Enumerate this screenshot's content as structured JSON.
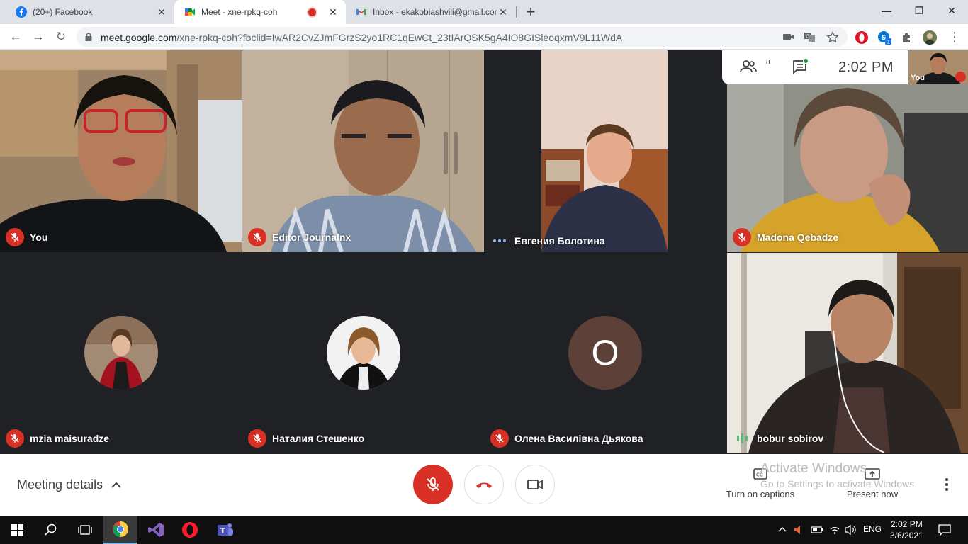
{
  "browser": {
    "tabs": [
      {
        "title": "(20+) Facebook",
        "icon": "facebook-icon"
      },
      {
        "title": "Meet - xne-rpkq-coh",
        "icon": "google-meet-icon",
        "recording": true
      },
      {
        "title": "Inbox - ekakobiashvili@gmail.com",
        "icon": "gmail-icon"
      }
    ],
    "url_host": "meet.google.com",
    "url_rest": "/xne-rpkq-coh?fbclid=IwAR2CvZJmFGrzS2yo1RC1qEwCt_23tIArQSK5gA4IO8GISleoqxmV9L11WdA",
    "extension_badge": "1"
  },
  "meet": {
    "participant_count": "8",
    "time": "2:02  PM",
    "self_label": "You",
    "participants": [
      {
        "name": "You",
        "status": "muted"
      },
      {
        "name": "Editor Journalnx",
        "status": "muted"
      },
      {
        "name": "Евгения Болотина",
        "status": "connecting"
      },
      {
        "name": "Madona Qebadze",
        "status": "muted"
      },
      {
        "name": "mzia maisuradze",
        "status": "muted"
      },
      {
        "name": "Наталия Стешенко",
        "status": "muted"
      },
      {
        "name": "Олена Василівна Дьякова",
        "status": "muted",
        "avatar_letter": "O"
      },
      {
        "name": "bobur sobirov",
        "status": "speaking"
      }
    ]
  },
  "controls": {
    "meeting_details": "Meeting details",
    "captions": "Turn on captions",
    "present": "Present now"
  },
  "watermark": {
    "line1": "Activate Windows",
    "line2": "Go to Settings to activate Windows."
  },
  "taskbar": {
    "language": "ENG",
    "time": "2:02 PM",
    "date": "3/6/2021"
  },
  "colors": {
    "meet_bg": "#202124",
    "mute_red": "#d93025",
    "tab_bar": "#dee1e6"
  }
}
